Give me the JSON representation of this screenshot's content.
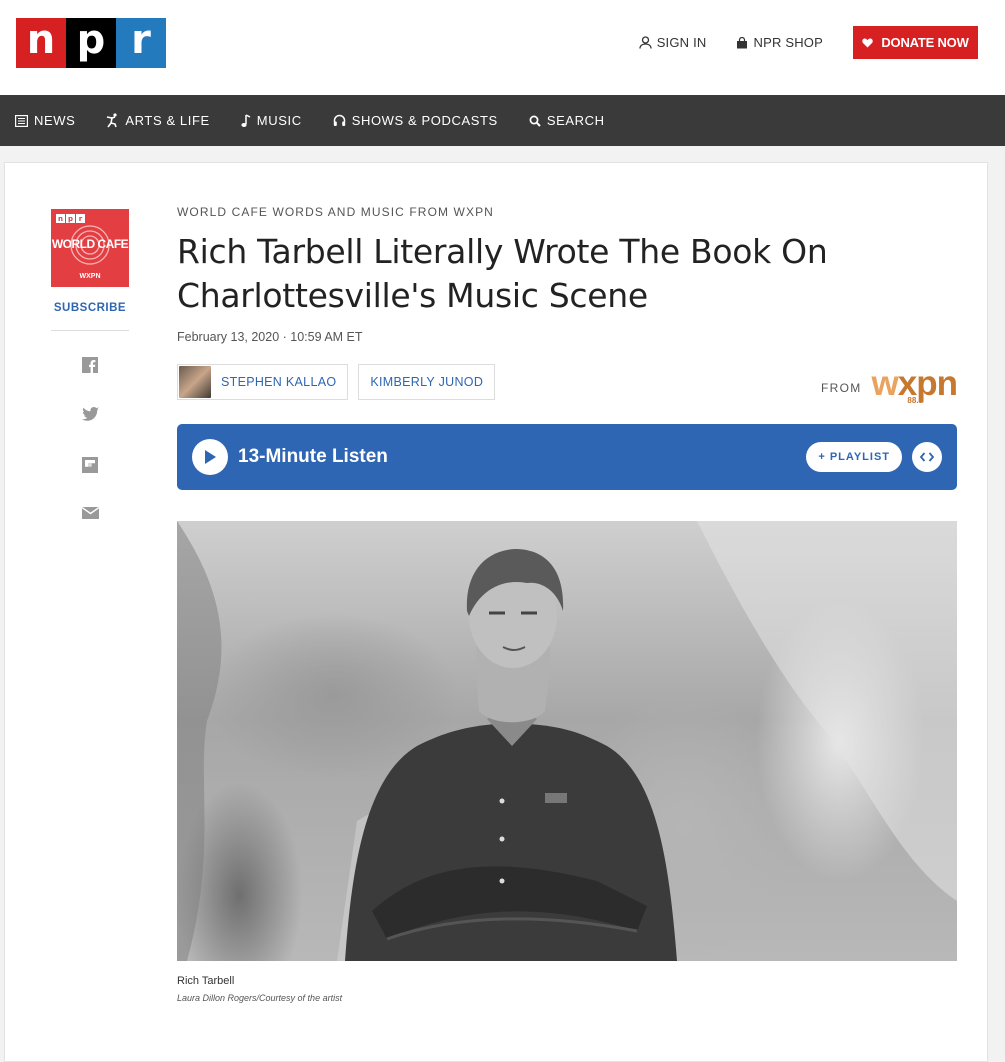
{
  "brand": {
    "letters": [
      "n",
      "p",
      "r"
    ],
    "colors": {
      "red": "#d62021",
      "black": "#000000",
      "blue": "#237bbd"
    }
  },
  "top_links": {
    "sign_in": "SIGN IN",
    "shop": "NPR SHOP",
    "donate": "DONATE NOW"
  },
  "nav": {
    "items": [
      {
        "label": "NEWS",
        "icon": "news-icon"
      },
      {
        "label": "ARTS & LIFE",
        "icon": "arts-icon"
      },
      {
        "label": "MUSIC",
        "icon": "music-note-icon"
      },
      {
        "label": "SHOWS & PODCASTS",
        "icon": "headphones-icon"
      },
      {
        "label": "SEARCH",
        "icon": "search-icon"
      }
    ]
  },
  "program": {
    "badge_npr": [
      "n",
      "p",
      "r"
    ],
    "badge_name": "WORLD CAFE",
    "badge_station": "WXPN",
    "subscribe": "SUBSCRIBE"
  },
  "share": [
    "facebook-icon",
    "twitter-icon",
    "flipboard-icon",
    "email-icon"
  ],
  "article": {
    "slug": "WORLD CAFE WORDS AND MUSIC FROM WXPN",
    "title": "Rich Tarbell Literally Wrote The Book On Charlottesville's Music Scene",
    "date": "February 13, 2020 · 10:59 AM ET",
    "bylines": [
      "STEPHEN KALLAO",
      "KIMBERLY JUNOD"
    ],
    "from_label": "FROM",
    "station_w": "w",
    "station_rest": "xpn",
    "station_freq": "88.5"
  },
  "player": {
    "title": "13-Minute Listen",
    "playlist": "+ PLAYLIST"
  },
  "photo": {
    "caption": "Rich Tarbell",
    "credit": "Laura Dillon Rogers/Courtesy of the artist"
  }
}
